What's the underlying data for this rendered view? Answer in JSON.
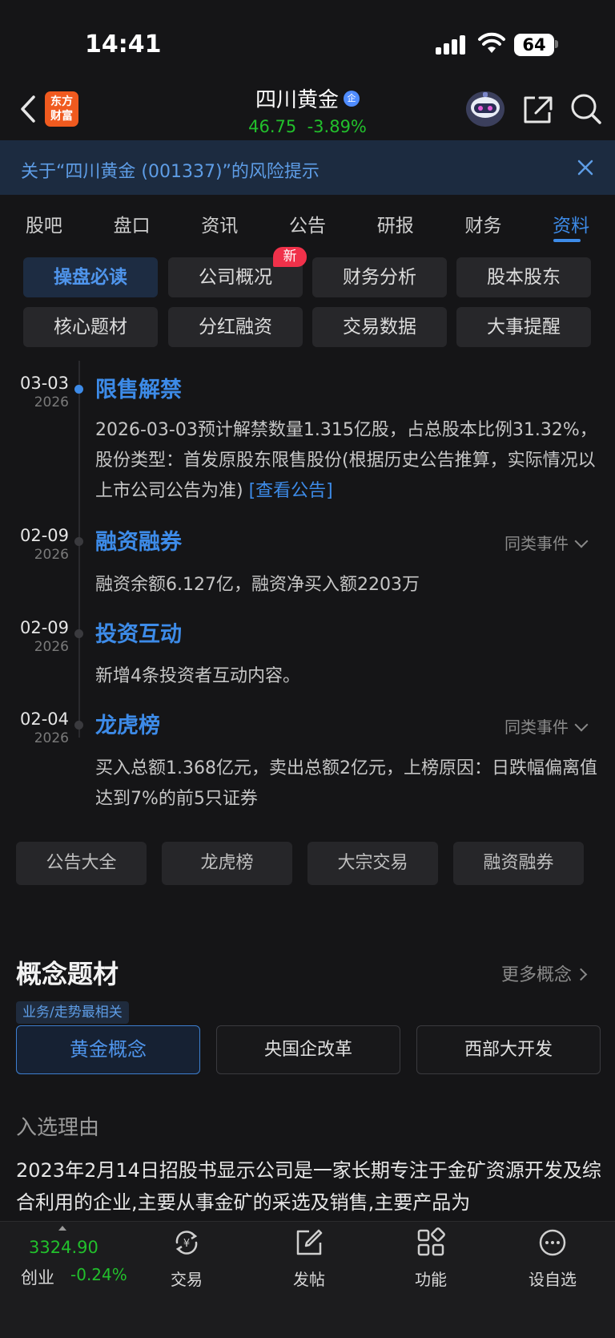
{
  "status_bar": {
    "time": "14:41",
    "battery": "64"
  },
  "header": {
    "logo_line1": "东方",
    "logo_line2": "财富",
    "stock_name": "四川黄金",
    "badge": "企",
    "price": "46.75",
    "change_pct": "-3.89%"
  },
  "banner": {
    "text": "关于“四川黄金 (001337)”的风险提示"
  },
  "tabs": [
    "股吧",
    "盘口",
    "资讯",
    "公告",
    "研报",
    "财务",
    "资料"
  ],
  "sub_buttons": [
    "操盘必读",
    "公司概况",
    "财务分析",
    "股本股东",
    "核心题材",
    "分红融资",
    "交易数据",
    "大事提醒"
  ],
  "new_badge": "新",
  "timeline": [
    {
      "date": "03-03",
      "year": "2026",
      "title": "限售解禁",
      "body": "2026-03-03预计解禁数量1.315亿股，占总股本比例31.32%，股份类型：首发原股东限售股份(根据历史公告推算，实际情况以上市公司公告为准)",
      "link": "[查看公告]"
    },
    {
      "date": "02-09",
      "year": "2026",
      "title": "融资融券",
      "similar": "同类事件",
      "body": "融资余额6.127亿，融资净买入额2203万"
    },
    {
      "date": "02-09",
      "year": "2026",
      "title": "投资互动",
      "body": "新增4条投资者互动内容。"
    },
    {
      "date": "02-04",
      "year": "2026",
      "title": "龙虎榜",
      "similar": "同类事件",
      "body": "买入总额1.368亿元，卖出总额2亿元，上榜原因：日跌幅偏离值达到7%的前5只证券"
    }
  ],
  "link_buttons": [
    "公告大全",
    "龙虎榜",
    "大宗交易",
    "融资融券"
  ],
  "concepts": {
    "heading": "概念题材",
    "more": "更多概念",
    "tag": "业务/走势最相关",
    "items": [
      "黄金概念",
      "央国企改革",
      "西部大开发"
    ],
    "reason_heading": "入选理由",
    "reason_text": "2023年2月14日招股书显示公司是一家长期专注于金矿资源开发及综合利用的企业,主要从事金矿的采选及销售,主要产品为"
  },
  "bottom_bar": {
    "index_value": "3324.90",
    "index_name": "创业",
    "index_change": "-0.24%",
    "nav": [
      "交易",
      "发帖",
      "功能",
      "设自选"
    ]
  },
  "colors": {
    "accent": "#3d8be8",
    "down": "#22c02c",
    "badge": "#f0314a",
    "brand": "#f05a1f"
  }
}
